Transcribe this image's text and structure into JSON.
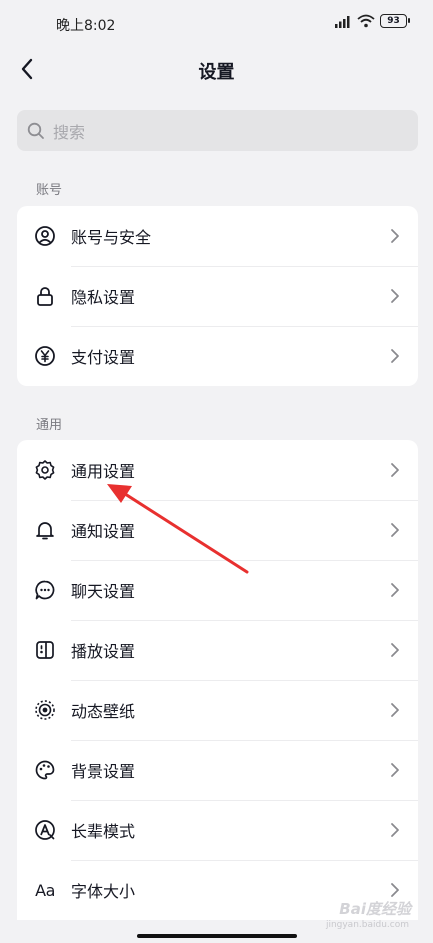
{
  "status_bar": {
    "time": "晚上8:02",
    "battery": "93"
  },
  "header": {
    "title": "设置"
  },
  "search": {
    "placeholder": "搜索"
  },
  "sections": {
    "account": {
      "label": "账号",
      "items": [
        {
          "label": "账号与安全",
          "icon": "user-circle-icon"
        },
        {
          "label": "隐私设置",
          "icon": "lock-icon"
        },
        {
          "label": "支付设置",
          "icon": "yen-icon"
        }
      ]
    },
    "general": {
      "label": "通用",
      "items": [
        {
          "label": "通用设置",
          "icon": "gear-icon"
        },
        {
          "label": "通知设置",
          "icon": "bell-icon"
        },
        {
          "label": "聊天设置",
          "icon": "chat-icon"
        },
        {
          "label": "播放设置",
          "icon": "play-settings-icon"
        },
        {
          "label": "动态壁纸",
          "icon": "live-wallpaper-icon"
        },
        {
          "label": "背景设置",
          "icon": "palette-icon"
        },
        {
          "label": "长辈模式",
          "icon": "elder-mode-icon"
        },
        {
          "label": "字体大小",
          "icon": "font-size-icon",
          "glyph": "Aa"
        }
      ]
    }
  },
  "watermark": {
    "text": "Bai度经验",
    "sub": "jingyan.baidu.com"
  },
  "colors": {
    "background": "#f2f2f4",
    "card": "#ffffff",
    "annotation_arrow": "#e8302f"
  }
}
